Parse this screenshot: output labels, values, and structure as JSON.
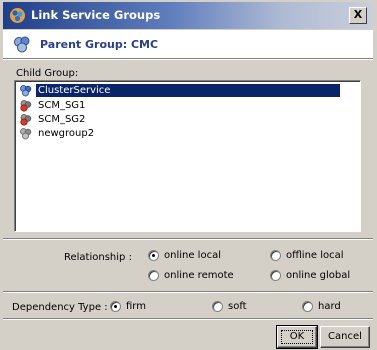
{
  "window": {
    "title": "Link Service Groups",
    "close_label": "X",
    "icons": {
      "title": "service-group-link-icon"
    }
  },
  "header": {
    "parent_group": "Parent Group: CMC",
    "icon": "service-group-icon"
  },
  "child_group": {
    "label": "Child Group:",
    "items": [
      {
        "label": "ClusterService",
        "icon": "cluster-service-icon",
        "selected": true
      },
      {
        "label": "SCM_SG1",
        "icon": "service-group-faulted-icon",
        "selected": false
      },
      {
        "label": "SCM_SG2",
        "icon": "service-group-faulted-icon",
        "selected": false
      },
      {
        "label": "newgroup2",
        "icon": "service-group-offline-icon",
        "selected": false
      }
    ]
  },
  "relationship": {
    "label": "Relationship :",
    "options": [
      {
        "label": "online local",
        "checked": true
      },
      {
        "label": "offline local",
        "checked": false
      },
      {
        "label": "online remote",
        "checked": false
      },
      {
        "label": "online global",
        "checked": false
      }
    ]
  },
  "dependency": {
    "label": "Dependency Type :",
    "options": [
      {
        "label": "firm",
        "checked": true
      },
      {
        "label": "soft",
        "checked": false
      },
      {
        "label": "hard",
        "checked": false
      }
    ]
  },
  "buttons": {
    "ok": "OK",
    "cancel": "Cancel"
  },
  "colors": {
    "title_start": "#203f8a",
    "selection": "#0a246a",
    "parent_text": "#2a3f86",
    "face": "#d4d0c8"
  }
}
